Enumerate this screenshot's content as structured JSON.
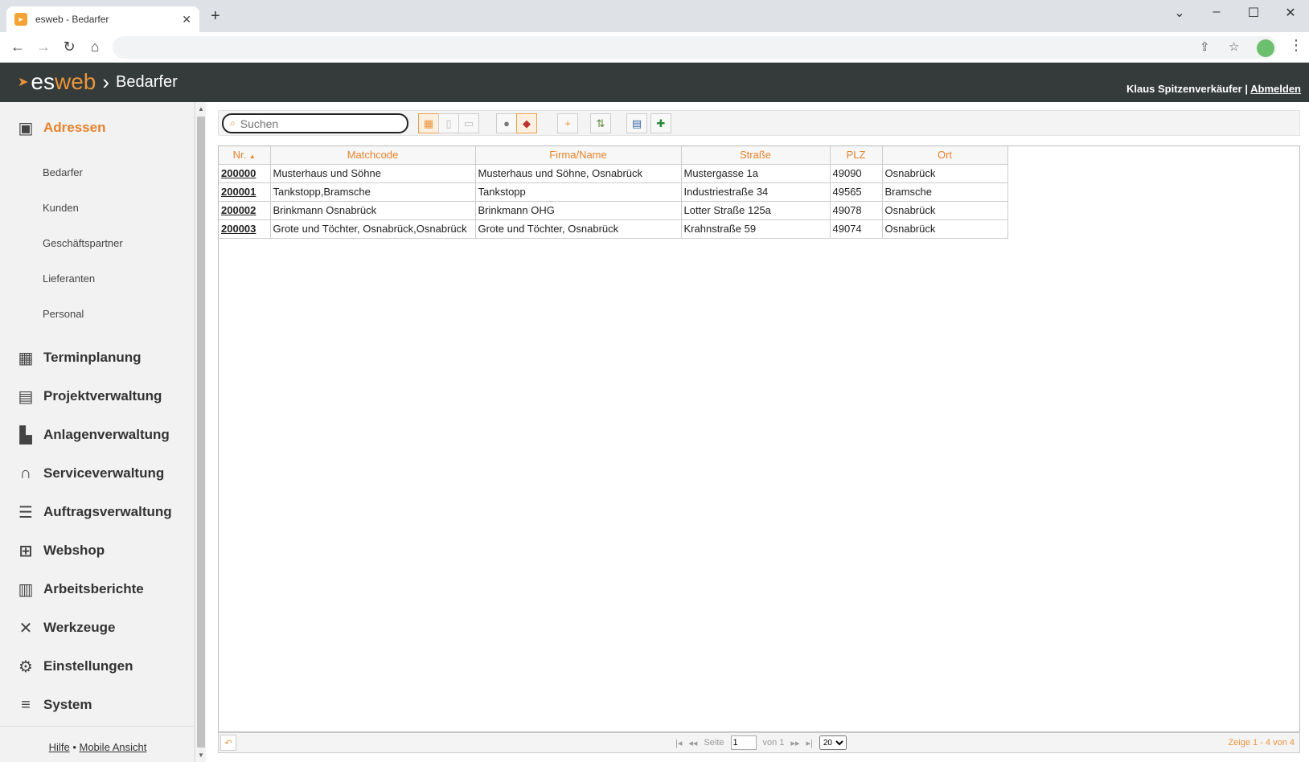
{
  "browser": {
    "tab_title": "esweb - Bedarfer",
    "tab_favicon": "bookmark-icon",
    "new_tab": "+",
    "minimize": "⌄",
    "min2": "–",
    "maximize": "☐",
    "close": "✕"
  },
  "header": {
    "brand_es": "es",
    "brand_web": "web",
    "separator": "›",
    "page": "Bedarfer",
    "user": "Klaus Spitzenverkäufer",
    "divider": "|",
    "logout": "Abmelden"
  },
  "sidebar": {
    "sections": [
      {
        "label": "Adressen",
        "icon": "address-book-icon",
        "active": true
      },
      {
        "label": "Terminplanung",
        "icon": "calendar-icon"
      },
      {
        "label": "Projektverwaltung",
        "icon": "gantt-icon"
      },
      {
        "label": "Anlagenverwaltung",
        "icon": "factory-icon"
      },
      {
        "label": "Serviceverwaltung",
        "icon": "headset-icon"
      },
      {
        "label": "Auftragsverwaltung",
        "icon": "list-icon"
      },
      {
        "label": "Webshop",
        "icon": "cart-icon"
      },
      {
        "label": "Arbeitsberichte",
        "icon": "clipboard-icon"
      },
      {
        "label": "Werkzeuge",
        "icon": "tools-icon"
      },
      {
        "label": "Einstellungen",
        "icon": "gears-icon"
      },
      {
        "label": "System",
        "icon": "database-icon"
      }
    ],
    "sub_items": [
      "Bedarfer",
      "Kunden",
      "Geschäftspartner",
      "Lieferanten",
      "Personal"
    ],
    "footer_help": "Hilfe",
    "footer_dot": "•",
    "footer_mobile": "Mobile Ansicht"
  },
  "toolbar": {
    "search_placeholder": "Suchen"
  },
  "table": {
    "columns": [
      "Nr.",
      "Matchcode",
      "Firma/Name",
      "Straße",
      "PLZ",
      "Ort"
    ],
    "rows": [
      [
        "200000",
        "Musterhaus und Söhne",
        "Musterhaus und Söhne, Osnabrück",
        "Mustergasse 1a",
        "49090",
        "Osnabrück"
      ],
      [
        "200001",
        "Tankstopp,Bramsche",
        "Tankstopp",
        "Industriestraße 34",
        "49565",
        "Bramsche"
      ],
      [
        "200002",
        "Brinkmann Osnabrück",
        "Brinkmann OHG",
        "Lotter Straße 125a",
        "49078",
        "Osnabrück"
      ],
      [
        "200003",
        "Grote und Töchter, Osnabrück,Osnabrück",
        "Grote und Töchter, Osnabrück",
        "Krahnstraße 59",
        "49074",
        "Osnabrück"
      ]
    ]
  },
  "pager": {
    "page_label": "Seite",
    "page_value": "1",
    "of_label": "von 1",
    "page_size": "20",
    "info": "Zeige 1 - 4 von 4"
  }
}
